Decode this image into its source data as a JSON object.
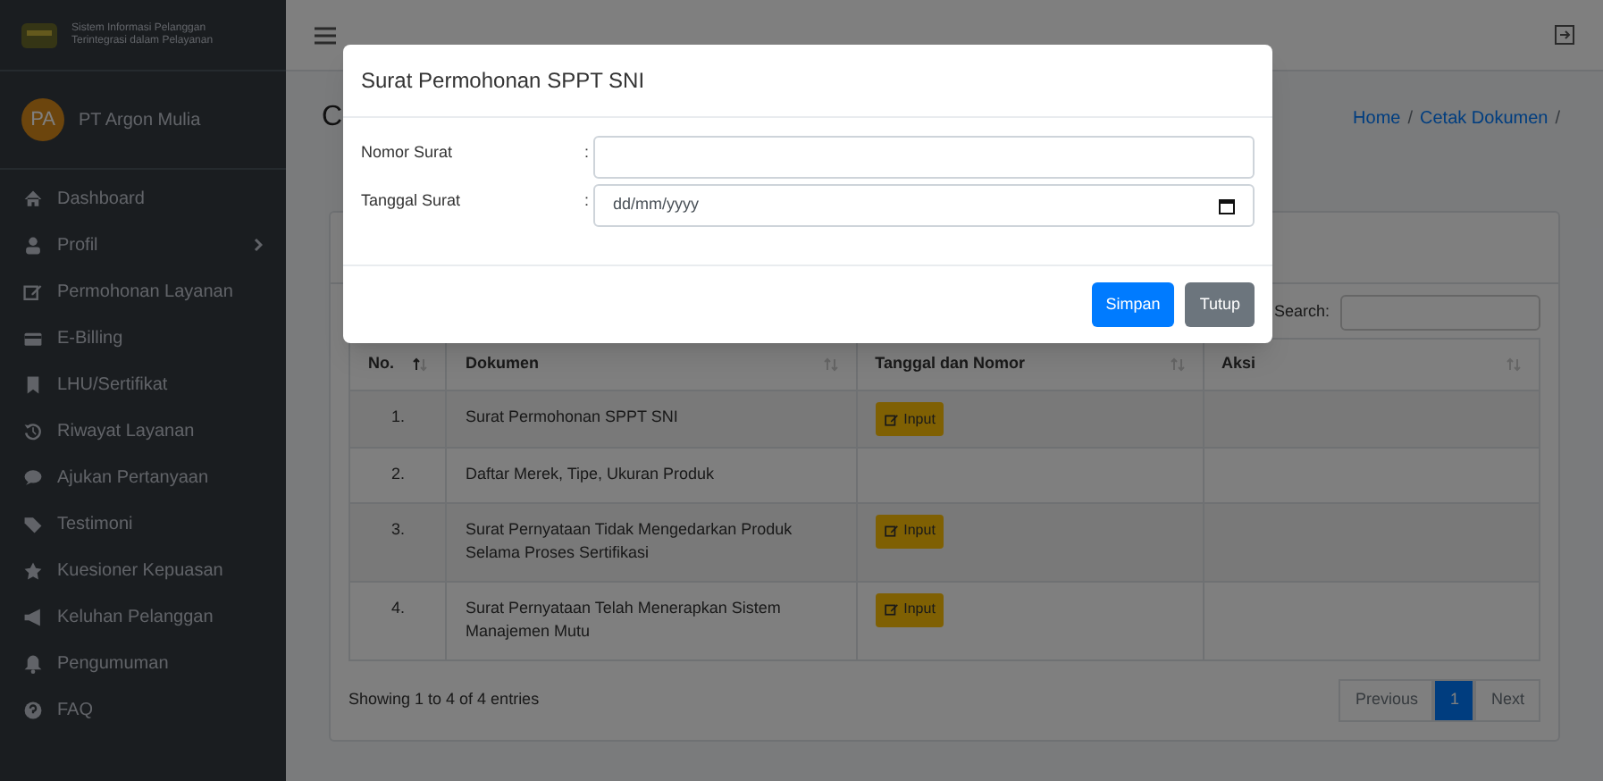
{
  "sidebar": {
    "brand": {
      "line_1": "Sistem Informasi Pelanggan",
      "line_2": "Terintegrasi dalam Pelayanan"
    },
    "user": {
      "initials": "PA",
      "name": "PT Argon Mulia"
    },
    "items": [
      {
        "label": "Dashboard",
        "kind": "link"
      },
      {
        "label": "Profil",
        "kind": "submenu"
      },
      {
        "label": "Permohonan Layanan",
        "kind": "link"
      },
      {
        "label": "E-Billing",
        "kind": "link"
      },
      {
        "label": "LHU/Sertifikat",
        "kind": "link"
      },
      {
        "label": "Riwayat Layanan",
        "kind": "link"
      },
      {
        "label": "Ajukan Pertanyaan",
        "kind": "link"
      },
      {
        "label": "Testimoni",
        "kind": "link"
      },
      {
        "label": "Kuesioner Kepuasan",
        "kind": "link"
      },
      {
        "label": "Keluhan Pelanggan",
        "kind": "link"
      },
      {
        "label": "Pengumuman",
        "kind": "link"
      },
      {
        "label": "FAQ",
        "kind": "link"
      }
    ]
  },
  "page_title": "C",
  "breadcrumb": [
    {
      "label": "Home",
      "separator": "/"
    },
    {
      "label": "Cetak Dokumen",
      "separator": "/"
    }
  ],
  "search": {
    "label": "Search:"
  },
  "table": {
    "columns": [
      {
        "label": "No.",
        "sorted": true
      },
      {
        "label": "Dokumen",
        "sorted": false
      },
      {
        "label": "Tanggal dan Nomor",
        "sorted": false
      },
      {
        "label": "Aksi",
        "sorted": false
      }
    ],
    "rows": [
      {
        "no": "1.",
        "dokumen": "Surat Permohonan SPPT SNI",
        "button": "Input"
      },
      {
        "no": "2.",
        "dokumen": "Daftar Merek, Tipe, Ukuran Produk"
      },
      {
        "no": "3.",
        "dokumen": "Surat Pernyataan Tidak Mengedarkan Produk Selama Proses Sertifikasi",
        "button": "Input"
      },
      {
        "no": "4.",
        "dokumen": "Surat Pernyataan Telah Menerapkan Sistem Manajemen Mutu",
        "button": "Input"
      }
    ]
  },
  "info": "Showing 1 to 4 of 4 entries",
  "pagination": [
    {
      "label": "Previous",
      "selected": false,
      "disabled": true
    },
    {
      "label": "1",
      "selected": true,
      "disabled": false
    },
    {
      "label": "Next",
      "selected": false,
      "disabled": true
    }
  ],
  "modal": {
    "title": "Surat Permohonan SPPT SNI",
    "fields": [
      {
        "label": "Nomor Surat",
        "separator": ":",
        "kind": "text"
      },
      {
        "label": "Tanggal Surat",
        "separator": ":",
        "kind": "date",
        "placeholder": "dd/mm/yyyy"
      }
    ],
    "buttons": [
      {
        "label": "Simpan",
        "kind": "primary"
      },
      {
        "label": "Tutup",
        "kind": "secondary"
      }
    ]
  }
}
